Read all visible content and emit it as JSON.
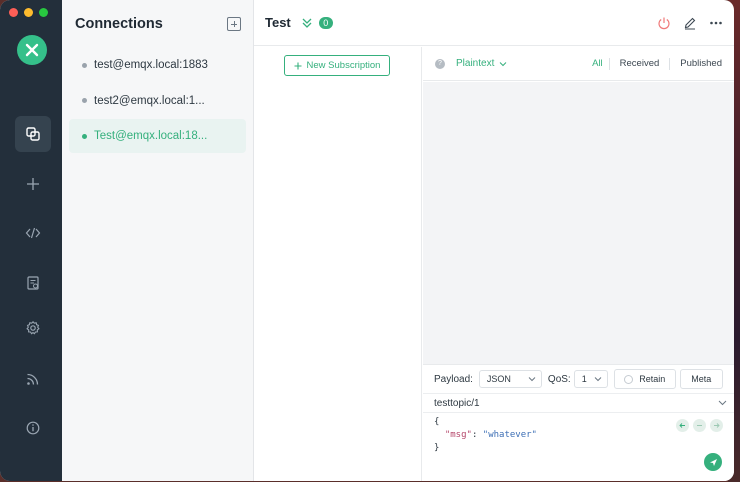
{
  "connections_panel": {
    "title": "Connections",
    "items": [
      {
        "label": "test@emqx.local:1883",
        "active": false
      },
      {
        "label": "test2@emqx.local:1...",
        "active": false
      },
      {
        "label": "Test@emqx.local:18...",
        "active": true
      }
    ]
  },
  "nav": {
    "items": [
      "connections-icon",
      "plus-icon",
      "code-icon",
      "log-icon",
      "gear-icon",
      "rss-icon",
      "info-icon"
    ]
  },
  "topbar": {
    "connection_name": "Test",
    "subscription_count": "0"
  },
  "subscriptions": {
    "new_button_label": "New Subscription"
  },
  "messages": {
    "format": "Plaintext",
    "filters": [
      "All",
      "Received",
      "Published"
    ],
    "active_filter": "All"
  },
  "composer": {
    "payload_label": "Payload:",
    "payload_format": "JSON",
    "qos_label": "QoS:",
    "qos_value": "1",
    "retain_label": "Retain",
    "meta_label": "Meta",
    "topic": "testtopic/1",
    "payload_open": "{",
    "payload_key": "\"msg\"",
    "payload_colon": ": ",
    "payload_value": "\"whatever\"",
    "payload_close": "}"
  },
  "colors": {
    "accent": "#35b07d",
    "nav_bg": "#232f3b"
  }
}
